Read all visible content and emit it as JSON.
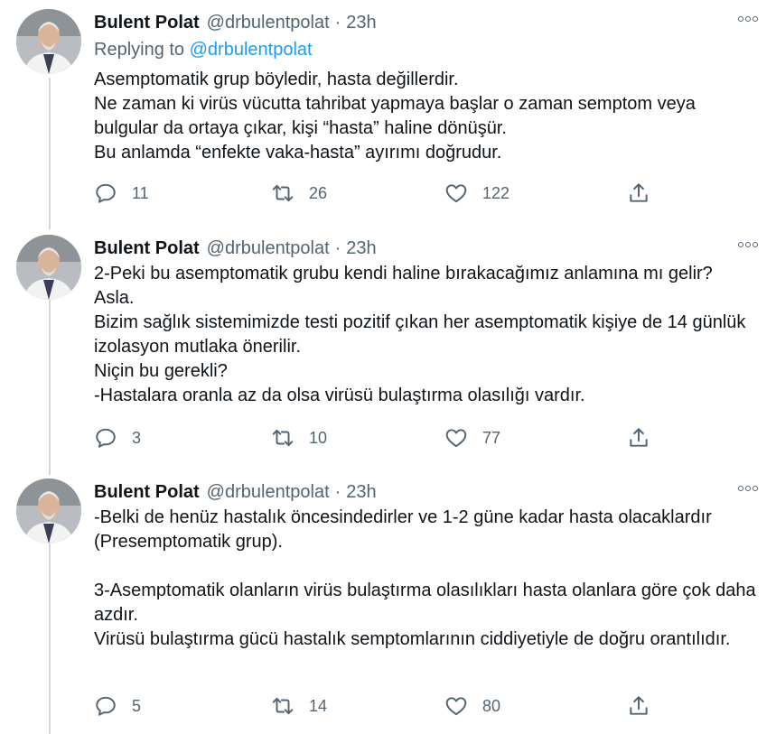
{
  "tweets": [
    {
      "name": "Bulent Polat",
      "handle": "@drbulentpolat",
      "separator": "·",
      "time": "23h",
      "replying_prefix": "Replying to",
      "replying_to": "@drbulentpolat",
      "text": "Asemptomatik grup böyledir, hasta değillerdir.\nNe zaman ki virüs vücutta tahribat yapmaya başlar o zaman semptom veya bulgular da ortaya çıkar, kişi “hasta” haline dönüşür.\nBu anlamda “enfekte vaka-hasta” ayırımı doğrudur.",
      "replies": "11",
      "retweets": "26",
      "likes": "122"
    },
    {
      "name": "Bulent Polat",
      "handle": "@drbulentpolat",
      "separator": "·",
      "time": "23h",
      "text": "2-Peki bu asemptomatik grubu kendi haline bırakacağımız anlamına mı gelir?\nAsla.\nBizim sağlık sistemimizde testi pozitif çıkan her asemptomatik kişiye de 14 günlük izolasyon mutlaka önerilir.\nNiçin bu gerekli?\n-Hastalara oranla az da olsa virüsü bulaştırma olasılığı vardır.",
      "replies": "3",
      "retweets": "10",
      "likes": "77"
    },
    {
      "name": "Bulent Polat",
      "handle": "@drbulentpolat",
      "separator": "·",
      "time": "23h",
      "text": "-Belki de henüz hastalık öncesindedirler ve 1-2 güne kadar hasta olacaklardır (Presemptomatik grup).\n\n3-Asemptomatik olanların virüs bulaştırma olasılıkları hasta olanlara göre çok daha azdır.\nVirüsü bulaştırma gücü hastalık semptomlarının ciddiyetiyle de doğru orantılıdır.",
      "replies": "5",
      "retweets": "14",
      "likes": "80"
    }
  ],
  "icons": {
    "reply": "reply-icon",
    "retweet": "retweet-icon",
    "like": "heart-icon",
    "share": "share-icon",
    "more": "more-icon"
  },
  "colors": {
    "text": "#0f1419",
    "secondary": "#536471",
    "link": "#1d9bf0",
    "thread_line": "#cfd9de"
  }
}
